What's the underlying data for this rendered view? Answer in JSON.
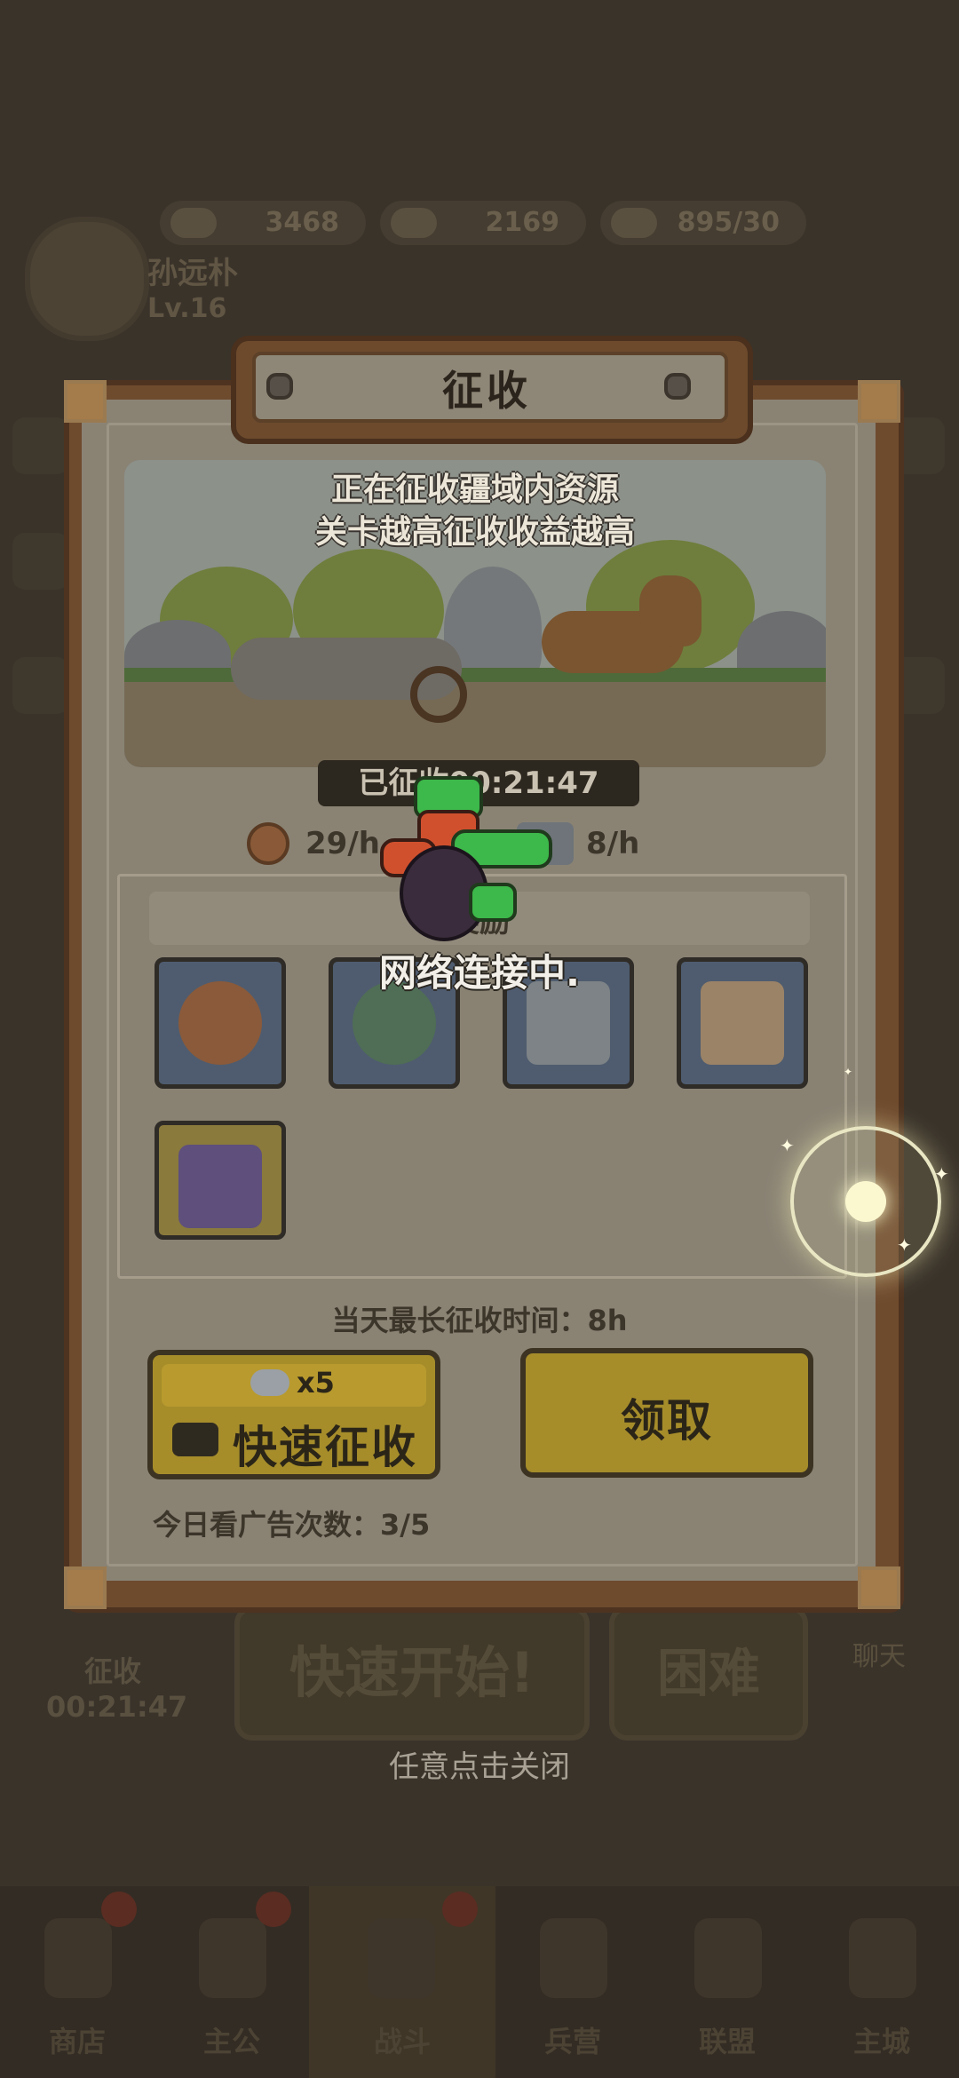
{
  "header": {
    "resources": [
      {
        "icon": "ingot-icon",
        "value": "3468"
      },
      {
        "icon": "gem-icon",
        "value": "2169"
      },
      {
        "icon": "food-icon",
        "value": "895/30"
      }
    ],
    "player_name": "孙远朴",
    "player_level": "Lv.16"
  },
  "panel": {
    "title": "征收",
    "caption_line1": "正在征收疆域内资源",
    "caption_line2": "关卡越高征收收益越高",
    "timer_label": "已征收",
    "timer_value": "00:21:47",
    "rate_coin": "29/h",
    "rate_scroll": "8/h",
    "reward_header": "奖励",
    "loading_text": "网络连接中.",
    "rewards": [
      {
        "icon": "copper-coin-icon"
      },
      {
        "icon": "jade-ring-icon"
      },
      {
        "icon": "mystery-scroll-icon"
      },
      {
        "icon": "mystery-scroll-icon"
      },
      {
        "icon": "mystery-chest-icon"
      }
    ],
    "max_time_text": "当天最长征收时间：8h",
    "quick_button": {
      "label": "快速征收",
      "cost_multiplier": "x5"
    },
    "claim_button": {
      "label": "领取"
    },
    "ad_count_text": "今日看广告次数：3/5"
  },
  "background": {
    "quick_start": "快速开始!",
    "difficulty": "困难",
    "conquest_label": "征收",
    "conquest_timer": "00:21:47",
    "chat": "聊天"
  },
  "close_hint": "任意点击关闭",
  "tabs": [
    {
      "label": "商店"
    },
    {
      "label": "主公"
    },
    {
      "label": "战斗"
    },
    {
      "label": "兵营"
    },
    {
      "label": "联盟"
    },
    {
      "label": "主城"
    }
  ],
  "colors": {
    "overlay": "#3b342b",
    "panel_frame": "#6f4b2e",
    "button_gold": "#a68d2a",
    "slot_blue": "#4f5c6f",
    "hero_green": "#3db84a"
  }
}
